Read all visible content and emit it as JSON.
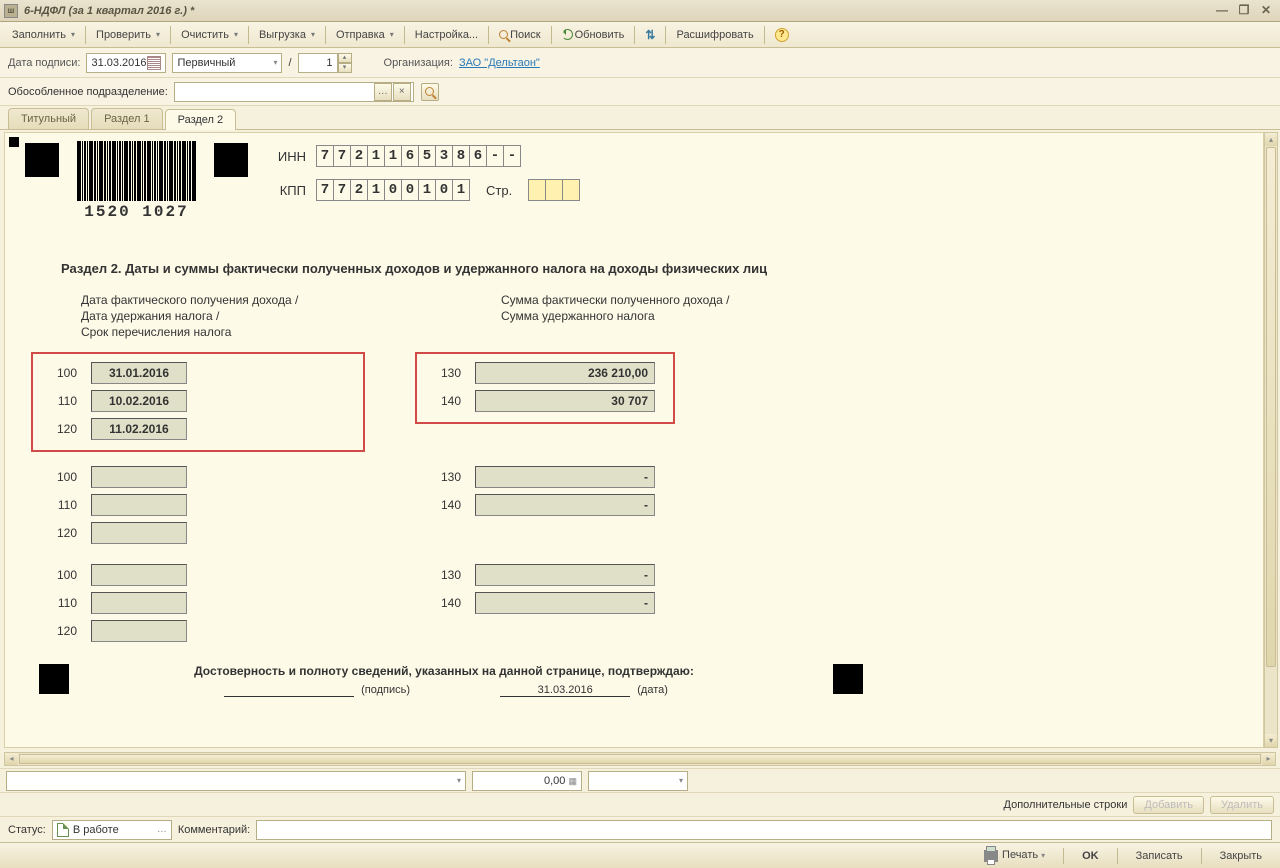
{
  "window": {
    "title": "6-НДФЛ (за 1 квартал 2016 г.) *"
  },
  "toolbar": {
    "fill": "Заполнить",
    "check": "Проверить",
    "clear": "Очистить",
    "export": "Выгрузка",
    "send": "Отправка",
    "settings": "Настройка...",
    "search": "Поиск",
    "refresh": "Обновить",
    "decode": "Расшифровать"
  },
  "params": {
    "sign_date_label": "Дата подписи:",
    "sign_date": "31.03.2016",
    "type": "Первичный",
    "slash": "/",
    "corr_num": "1",
    "org_label": "Организация:",
    "org": "ЗАО \"Дельтаон\"",
    "subdiv_label": "Обособленное подразделение:"
  },
  "tabs": {
    "t1": "Титульный",
    "t2": "Раздел 1",
    "t3": "Раздел 2"
  },
  "doc": {
    "inn_label": "ИНН",
    "kpp_label": "КПП",
    "str_label": "Стр.",
    "inn": [
      "7",
      "7",
      "2",
      "1",
      "1",
      "6",
      "5",
      "3",
      "8",
      "6",
      "-",
      "-"
    ],
    "kpp": [
      "7",
      "7",
      "2",
      "1",
      "0",
      "0",
      "1",
      "0",
      "1"
    ],
    "barcode_text": "1520 1027",
    "section_title": "Раздел 2.  Даты и суммы фактически полученных доходов и удержанного налога на доходы физических лиц",
    "left_header": "Дата фактического получения дохода /\nДата удержания налога /\nСрок перечисления налога",
    "right_header": "Сумма фактически полученного дохода /\nСумма удержанного налога",
    "block1": {
      "c100": "100",
      "v100": "31.01.2016",
      "c110": "110",
      "v110": "10.02.2016",
      "c120": "120",
      "v120": "11.02.2016",
      "c130": "130",
      "v130": "236 210,00",
      "c140": "140",
      "v140": "30 707"
    },
    "block2": {
      "c100": "100",
      "v100": "",
      "c110": "110",
      "v110": "",
      "c120": "120",
      "v120": "",
      "c130": "130",
      "v130": "-",
      "c140": "140",
      "v140": "-"
    },
    "block3": {
      "c100": "100",
      "v100": "",
      "c110": "110",
      "v110": "",
      "c120": "120",
      "v120": "",
      "c130": "130",
      "v130": "-",
      "c140": "140",
      "v140": "-"
    },
    "signature": {
      "text": "Достоверность и полноту сведений, указанных на данной странице, подтверждаю:",
      "sign_label": "(подпись)",
      "date": "31.03.2016",
      "date_label": "(дата)"
    }
  },
  "aux": {
    "amount": "0,00",
    "extra_label": "Дополнительные строки",
    "add": "Добавить",
    "del": "Удалить"
  },
  "status": {
    "label": "Статус:",
    "value": "В работе",
    "comment_label": "Комментарий:"
  },
  "footer": {
    "print": "Печать",
    "ok": "OK",
    "save": "Записать",
    "close": "Закрыть"
  }
}
